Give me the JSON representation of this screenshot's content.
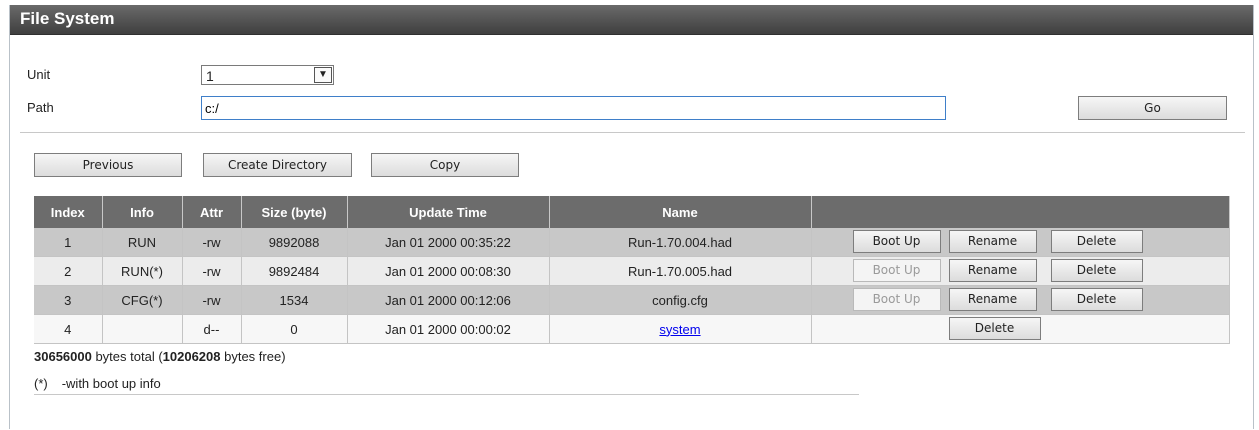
{
  "window": {
    "title": "File System"
  },
  "form": {
    "unit_label": "Unit",
    "unit_value": "1",
    "path_label": "Path",
    "path_value": "c:/",
    "go_label": "Go"
  },
  "toolbar": {
    "previous_label": "Previous",
    "create_directory_label": "Create Directory",
    "copy_label": "Copy"
  },
  "table": {
    "headers": [
      "Index",
      "Info",
      "Attr",
      "Size (byte)",
      "Update Time",
      "Name",
      ""
    ],
    "rows": [
      {
        "index": "1",
        "info": "RUN",
        "attr": "-rw",
        "size": "9892088",
        "time": "Jan 01 2000 00:35:22",
        "name": "Run-1.70.004.had",
        "boot": "Boot Up",
        "rename": "Rename",
        "delete": "Delete"
      },
      {
        "index": "2",
        "info": "RUN(*)",
        "attr": "-rw",
        "size": "9892484",
        "time": "Jan 01 2000 00:08:30",
        "name": "Run-1.70.005.had",
        "boot": "Boot Up",
        "rename": "Rename",
        "delete": "Delete"
      },
      {
        "index": "3",
        "info": "CFG(*)",
        "attr": "-rw",
        "size": "1534",
        "time": "Jan 01 2000 00:12:06",
        "name": "config.cfg",
        "boot": "Boot Up",
        "rename": "Rename",
        "delete": "Delete"
      },
      {
        "index": "4",
        "info": "",
        "attr": "d--",
        "size": "0",
        "time": "Jan 01 2000 00:00:02",
        "name": "system",
        "delete": "Delete"
      }
    ]
  },
  "summary": {
    "total_bytes": "30656000",
    "total_text": " bytes total (",
    "free_bytes": "10206208",
    "free_text": " bytes free)"
  },
  "note": {
    "marker": "(*)",
    "text": "-with boot up info"
  }
}
